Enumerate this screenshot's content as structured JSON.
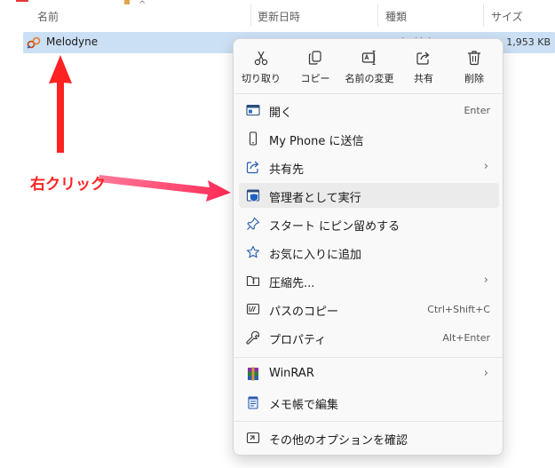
{
  "explorer": {
    "columns": {
      "name": "名前",
      "modified": "更新日時",
      "type": "種類",
      "size": "サイズ"
    },
    "file": {
      "name": "Melodyne",
      "type_partial": "ｼｮｰﾄｶｯﾄ",
      "size": "1,953 KB"
    }
  },
  "annotation": {
    "label": "右クリック",
    "color": "#ff2222"
  },
  "context_menu": {
    "quick_actions": [
      {
        "label": "切り取り",
        "icon": "scissors-icon"
      },
      {
        "label": "コピー",
        "icon": "copy-icon"
      },
      {
        "label": "名前の変更",
        "icon": "rename-icon"
      },
      {
        "label": "共有",
        "icon": "share-icon"
      },
      {
        "label": "削除",
        "icon": "trash-icon"
      }
    ],
    "items": [
      {
        "label": "開く",
        "shortcut": "Enter",
        "icon": "open-icon"
      },
      {
        "label": "My Phone に送信",
        "icon": "phone-icon"
      },
      {
        "label": "共有先",
        "icon": "share-to-icon",
        "submenu": true
      },
      {
        "label": "管理者として実行",
        "icon": "shield-icon",
        "highlighted": true
      },
      {
        "label": "スタート にピン留めする",
        "icon": "pin-icon"
      },
      {
        "label": "お気に入りに追加",
        "icon": "star-icon"
      },
      {
        "label": "圧縮先...",
        "icon": "zip-folder-icon",
        "submenu": true
      },
      {
        "label": "パスのコピー",
        "shortcut": "Ctrl+Shift+C",
        "icon": "copy-path-icon"
      },
      {
        "label": "プロパティ",
        "shortcut": "Alt+Enter",
        "icon": "wrench-icon"
      },
      {
        "label": "WinRAR",
        "icon": "winrar-icon",
        "submenu": true
      },
      {
        "label": "メモ帳で編集",
        "icon": "notepad-icon"
      },
      {
        "label": "その他のオプションを確認",
        "icon": "more-options-icon"
      }
    ],
    "chevron": "›"
  },
  "colors": {
    "selection": "#cce0f5",
    "accent": "#0067c0",
    "annotation": "#ff2222"
  }
}
